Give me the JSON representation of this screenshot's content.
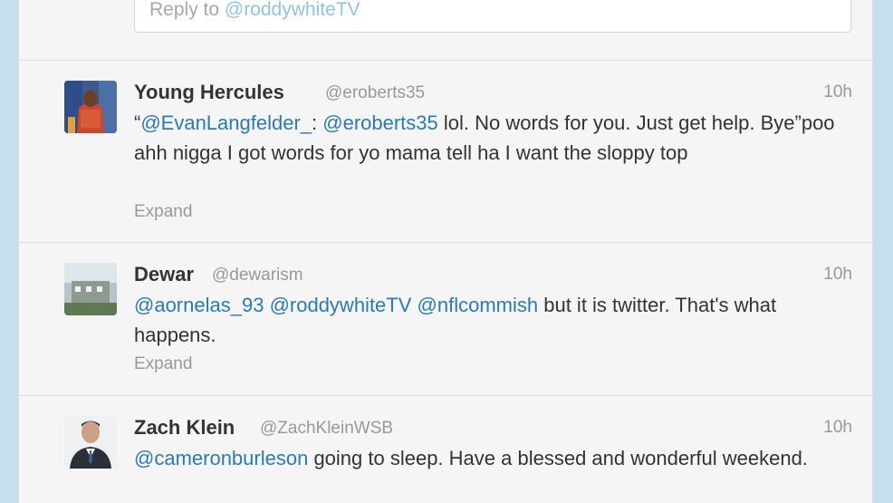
{
  "reply": {
    "prefix": "Reply to ",
    "mention": "@roddywhiteTV"
  },
  "tweets": [
    {
      "fullname": "Young Hercules",
      "username": "@eroberts35",
      "time": "10h",
      "segments": [
        {
          "text": "“",
          "mention": false
        },
        {
          "text": "@EvanLangfelder_",
          "mention": true
        },
        {
          "text": ": ",
          "mention": false
        },
        {
          "text": "@eroberts35",
          "mention": true
        },
        {
          "text": " lol. No words for you. Just get help. Bye”poo ahh nigga I got words for yo mama tell ha I want the sloppy top",
          "mention": false
        }
      ],
      "expand": "Expand"
    },
    {
      "fullname": "Dewar",
      "username": "@dewarism",
      "time": "10h",
      "segments": [
        {
          "text": "@aornelas_93",
          "mention": true
        },
        {
          "text": " ",
          "mention": false
        },
        {
          "text": "@roddywhiteTV",
          "mention": true
        },
        {
          "text": " ",
          "mention": false
        },
        {
          "text": "@nflcommish",
          "mention": true
        },
        {
          "text": " but it is twitter.  That's what happens.",
          "mention": false
        }
      ],
      "expand": "Expand"
    },
    {
      "fullname": "Zach Klein",
      "username": "@ZachKleinWSB",
      "time": "10h",
      "segments": [
        {
          "text": "@cameronburleson",
          "mention": true
        },
        {
          "text": " going to sleep. Have a blessed and wonderful weekend.",
          "mention": false
        }
      ]
    }
  ],
  "colors": {
    "page_background": "#c6dfee",
    "column_background": "#f5f5f5",
    "mention": "#2a7ab8",
    "muted": "#999999",
    "text": "#333333"
  }
}
